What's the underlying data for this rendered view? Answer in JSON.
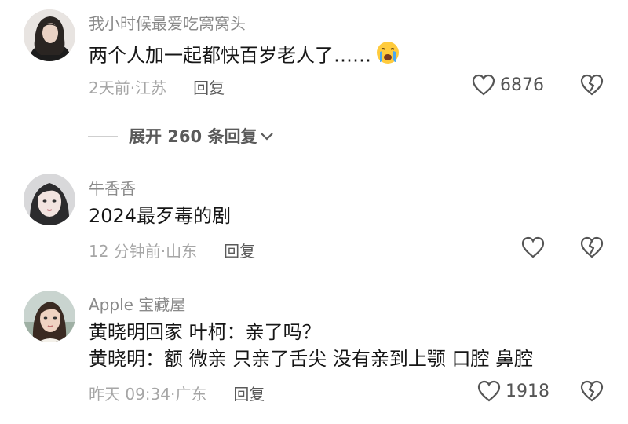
{
  "comments": [
    {
      "username": "我小时候最爱吃窝窝头",
      "text_lines": [
        "两个人加一起都快百岁老人了……"
      ],
      "emoji": "crying-face",
      "meta": "2天前·江苏",
      "reply": "回复",
      "likes": "6876"
    },
    {
      "username": "牛香香",
      "text_lines": [
        "2024最歹毒的剧"
      ],
      "meta": "12 分钟前·山东",
      "reply": "回复",
      "likes": ""
    },
    {
      "username": "Apple 宝藏屋",
      "text_lines": [
        "黄晓明回家 叶柯：亲了吗？",
        "黄晓明：额 微亲 只亲了舌尖 没有亲到上颚 口腔 鼻腔"
      ],
      "meta": "昨天 09:34·广东",
      "reply": "回复",
      "likes": "1918"
    }
  ],
  "expand_replies": {
    "label": "展开 260 条回复"
  },
  "colors": {
    "text": "#161616",
    "secondary": "#8a8a8a",
    "meta": "#a6a6a6"
  }
}
